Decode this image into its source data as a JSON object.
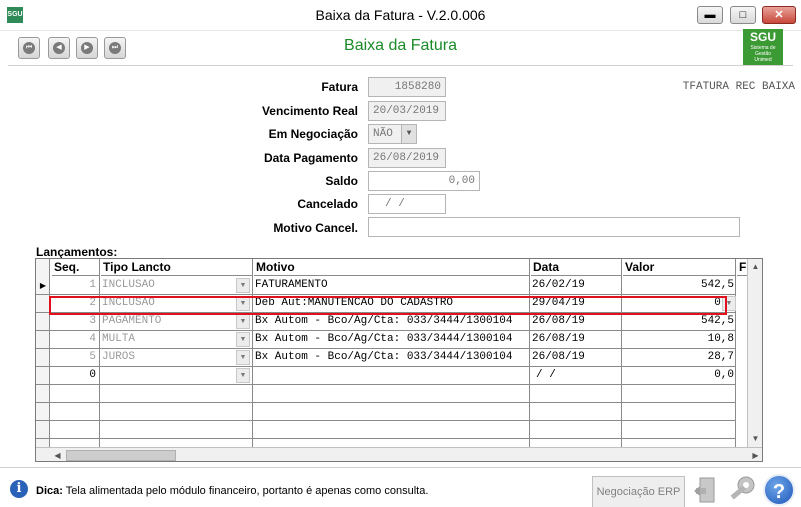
{
  "window": {
    "app_icon": "SGU",
    "title": "Baixa da Fatura - V.2.0.006",
    "controls": {
      "minimize": "▬",
      "maximize": "□",
      "close": "✕"
    }
  },
  "header": {
    "title": "Baixa da Fatura",
    "nav": {
      "first": "⏮",
      "prev": "◀",
      "next": "▶",
      "last": "⏭"
    },
    "logo": {
      "text": "SGU",
      "sub1": "Sistema de Gestão",
      "sub2": "Unimed"
    }
  },
  "form": {
    "tag": "TFATURA REC BAIXA",
    "fatura": {
      "label": "Fatura",
      "value": "1858280"
    },
    "vencimento": {
      "label": "Vencimento Real",
      "value": "20/03/2019"
    },
    "negociacao": {
      "label": "Em Negociação",
      "value": "NÃO"
    },
    "data_pagamento": {
      "label": "Data Pagamento",
      "value": "26/08/2019"
    },
    "saldo": {
      "label": "Saldo",
      "value": "0,00"
    },
    "cancelado": {
      "label": "Cancelado",
      "value": "/  /"
    },
    "motivo_cancel": {
      "label": "Motivo Cancel.",
      "value": ""
    }
  },
  "grid": {
    "label": "Lançamentos:",
    "columns": [
      "Seq.",
      "Tipo Lancto",
      "Motivo",
      "Data",
      "Valor",
      "F"
    ],
    "rows": [
      {
        "seq": "1",
        "tipo": "INCLUSAO",
        "motivo": "FATURAMENTO",
        "data": "26/02/19",
        "valor": "542,5"
      },
      {
        "seq": "2",
        "tipo": "INCLUSAO",
        "motivo": "Deb Aut:MANUTENCAO DO CADASTRO",
        "data": "29/04/19",
        "valor": "0,0"
      },
      {
        "seq": "3",
        "tipo": "PAGAMENTO",
        "motivo": "Bx Autom - Bco/Ag/Cta: 033/3444/1300104",
        "data": "26/08/19",
        "valor": "542,5"
      },
      {
        "seq": "4",
        "tipo": "MULTA",
        "motivo": "Bx Autom - Bco/Ag/Cta: 033/3444/1300104",
        "data": "26/08/19",
        "valor": "10,8"
      },
      {
        "seq": "5",
        "tipo": "JUROS",
        "motivo": "Bx Autom - Bco/Ag/Cta: 033/3444/1300104",
        "data": "26/08/19",
        "valor": "28,7"
      },
      {
        "seq": "0",
        "tipo": "",
        "motivo": "",
        "data": "/  /",
        "valor": "0,0"
      }
    ]
  },
  "footer": {
    "tip_label": "Dica:",
    "tip_text": "Tela alimentada pelo módulo financeiro, portanto é apenas como consulta.",
    "negociacao_button": "Negociação ERP",
    "help": "?"
  },
  "colors": {
    "title_green": "#1a8a2a",
    "highlight": "#e0101c",
    "help_blue": "#1f56b8"
  }
}
